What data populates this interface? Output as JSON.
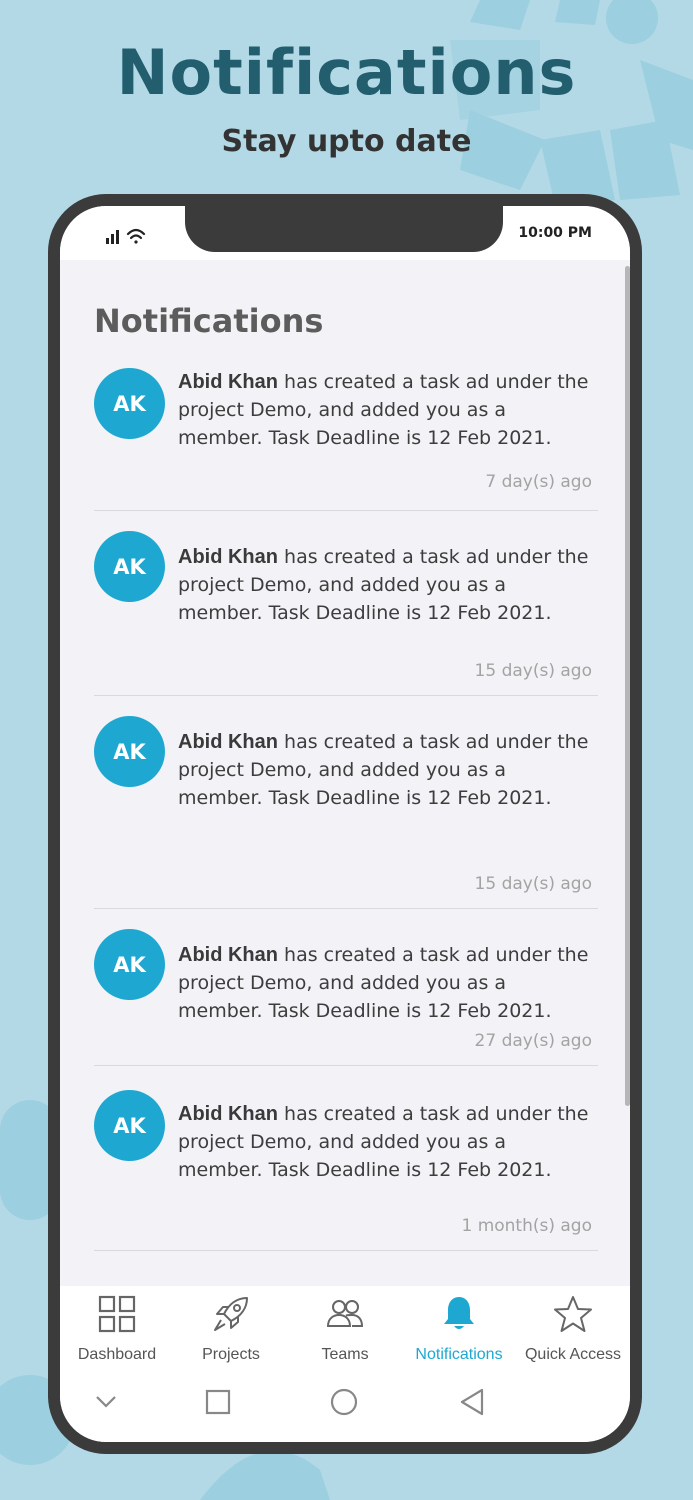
{
  "promo": {
    "title": "Notifications",
    "subtitle": "Stay upto date"
  },
  "status_bar": {
    "time": "10:00 PM",
    "icons": [
      "signal-icon",
      "wifi-icon"
    ]
  },
  "screen": {
    "title": "Notifications"
  },
  "notifications": [
    {
      "initials": "AK",
      "name": "Abid Khan",
      "text": " has created a task ad under the project Demo, and added you as a member. Task Deadline is 12 Feb 2021.",
      "ago": "7 day(s) ago"
    },
    {
      "initials": "AK",
      "name": "Abid Khan",
      "text": " has created a task ad under the project Demo, and added you as a member. Task Deadline is 12 Feb 2021.",
      "ago": "15 day(s) ago"
    },
    {
      "initials": "AK",
      "name": "Abid Khan",
      "text": " has created a task ad under the project Demo, and added you as a member. Task Deadline is 12 Feb 2021.",
      "ago": "15 day(s) ago"
    },
    {
      "initials": "AK",
      "name": "Abid Khan",
      "text": " has created a task ad under the project Demo, and added you as a member. Task Deadline is 12 Feb 2021.",
      "ago": "27 day(s) ago"
    },
    {
      "initials": "AK",
      "name": "Abid Khan",
      "text": " has created a task ad under the project Demo, and added you as a member. Task Deadline is 12 Feb 2021.",
      "ago": "1 month(s) ago"
    }
  ],
  "bottom_nav": {
    "items": [
      {
        "label": "Dashboard",
        "icon": "grid-icon",
        "active": false
      },
      {
        "label": "Projects",
        "icon": "rocket-icon",
        "active": false
      },
      {
        "label": "Teams",
        "icon": "people-icon",
        "active": false
      },
      {
        "label": "Notifications",
        "icon": "bell-icon",
        "active": true
      },
      {
        "label": "Quick Access",
        "icon": "star-icon",
        "active": false
      }
    ],
    "active_color": "#1ea8d1"
  },
  "system_nav": {
    "icons": [
      "chevron-down-icon",
      "square-icon",
      "circle-icon",
      "back-triangle-icon"
    ]
  },
  "colors": {
    "background": "#b3d9e6",
    "title": "#225e6e",
    "avatar": "#1ea8d1"
  }
}
